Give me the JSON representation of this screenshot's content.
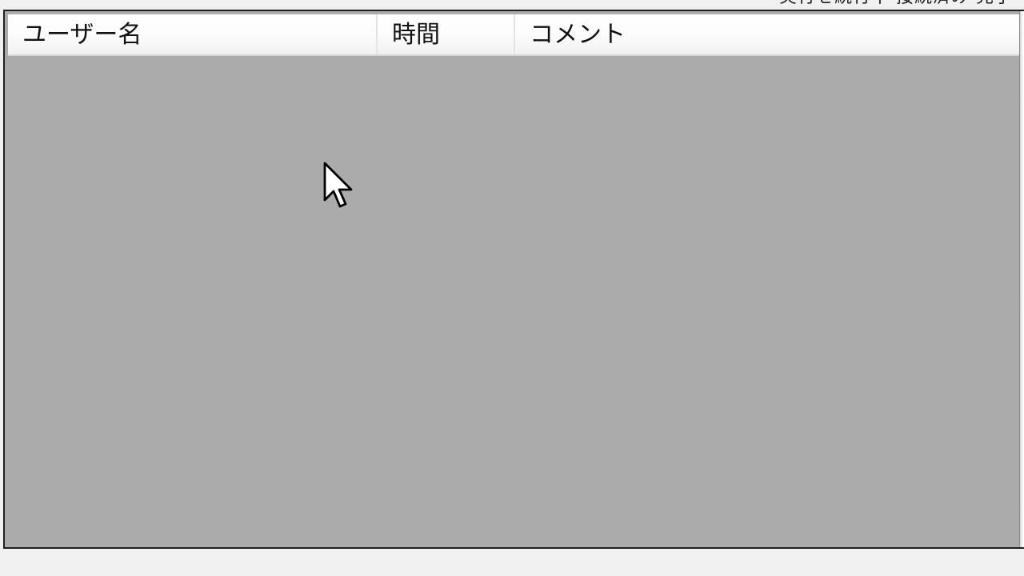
{
  "top_cutoff_text": "実行を続行中 接続済み 完了",
  "listview": {
    "columns": [
      {
        "label": "ユーザー名"
      },
      {
        "label": "時間"
      },
      {
        "label": "コメント"
      }
    ],
    "rows": []
  },
  "icons": {
    "cursor": "mouse-pointer-icon"
  },
  "colors": {
    "list_background": "#ababab",
    "header_background": "#f7f7f7",
    "window_background": "#f0f0f0",
    "border": "#1e1e1e"
  }
}
